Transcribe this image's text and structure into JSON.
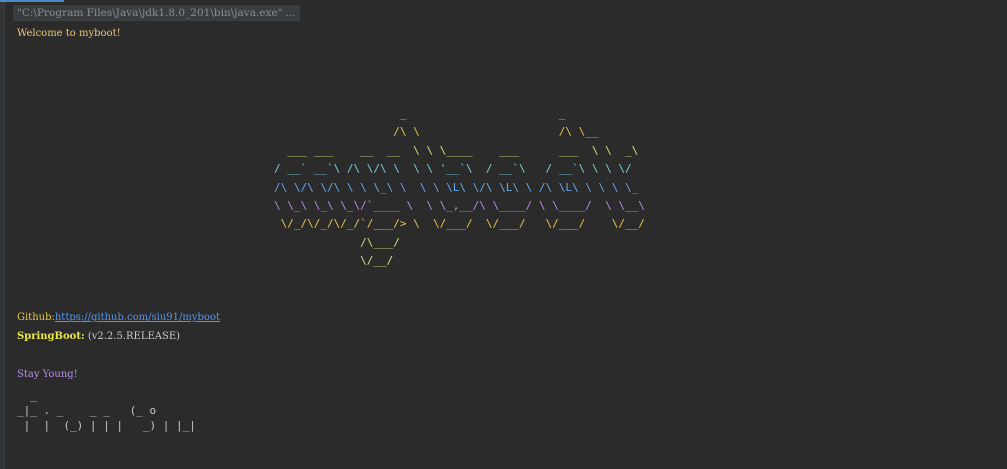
{
  "console": {
    "command": "\"C:\\Program Files\\Java\\jdk1.8.0_201\\bin\\java.exe\" ...",
    "welcome": "Welcome to myboot!",
    "banner_lines": [
      "                   _                       _",
      "                  /\\ \\                     /\\ \\__",
      "  ___ ___    __  __  \\ \\ \\____    ___      ___  \\ \\  _\\",
      "/ __` __`\\ /\\ \\/\\ \\  \\ \\ '__`\\  / __`\\   / __`\\ \\ \\ \\/",
      "/\\ \\/\\ \\/\\ \\ \\ \\_\\ \\  \\ \\ \\L\\ \\/\\ \\L\\ \\ /\\ \\L\\ \\ \\ \\ \\_",
      "\\ \\_\\ \\_\\ \\_\\/`____ \\  \\ \\_,__/\\ \\____/ \\ \\____/  \\ \\__\\",
      " \\/_/\\/_/\\/_/`/___/> \\  \\/___/  \\/___/   \\/___/    \\/__/",
      "             /\\___/",
      "             \\/__/"
    ],
    "github_label": "Github:",
    "github_url": "https://github.com/siu91/myboot",
    "springboot_label": "SpringBoot:",
    "springboot_version": " (v2.2.5.RELEASE)",
    "stay_young": "Stay Young!",
    "logo_lines": [
      "  _",
      "_|_ . _    _ _   (_ o",
      " |  |  (_) | | |   _) | |_|"
    ]
  },
  "colors": {
    "background": "#2b2b2b",
    "welcome": "#f0c674",
    "link": "#5394ec",
    "stay_young": "#b78ee6"
  }
}
